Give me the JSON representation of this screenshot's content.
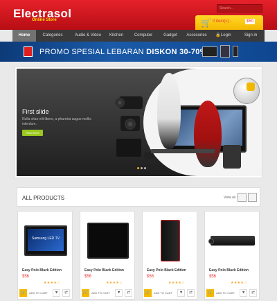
{
  "header": {
    "logo_title": "Electrasol",
    "logo_subtitle": "Online Store",
    "search_placeholder": "Search...",
    "cart_text": "0 item(s) - ",
    "cart_price": "$50",
    "cart_icon": "cart-icon"
  },
  "nav": {
    "items": [
      {
        "label": "Home"
      },
      {
        "label": "Categories"
      },
      {
        "label": "Audio & Video"
      },
      {
        "label": "Kitchen"
      },
      {
        "label": "Computer"
      },
      {
        "label": "Gadget"
      },
      {
        "label": "Accesories"
      }
    ],
    "login": "🔒Login",
    "signin": "Sign in"
  },
  "promo": {
    "text_normal": "PROMO SPESIAL LEBARAN ",
    "text_bold": "DISKON 30-70%"
  },
  "slider": {
    "title": "First slide",
    "description": "Nulla vitae elit libero, a pharetra augue mollis interdum.",
    "button": "Read more"
  },
  "products_bar": {
    "title": "ALL PRODUCTS",
    "view_as": "View as :"
  },
  "products": [
    {
      "name": "Easy Polo Black Edition",
      "price": "$56",
      "stars": "★★★★☆",
      "add_label": "ADD TO CART",
      "tv_label": "Samsung LED TV"
    },
    {
      "name": "Easy Polo Black Edition",
      "price": "$56",
      "stars": "★★★★☆",
      "add_label": "ADD TO CART"
    },
    {
      "name": "Easy Polo Black Edition",
      "price": "$56",
      "stars": "★★★★☆",
      "add_label": "ADD TO CART"
    },
    {
      "name": "Easy Polo Black Edition",
      "price": "$56",
      "stars": "★★★★☆",
      "add_label": "ADD TO CART"
    }
  ],
  "colors": {
    "header_red": "#d4161e",
    "cart_yellow": "#f5b800",
    "nav_dark": "#3a3a3a",
    "promo_blue": "#1a5aa8",
    "price_red": "#e33333",
    "slide_button_green": "#9ac81e"
  }
}
